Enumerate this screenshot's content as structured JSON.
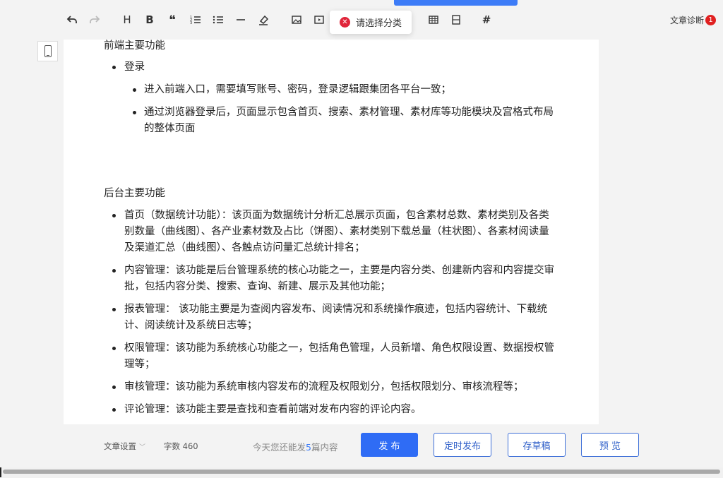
{
  "toolbar": {
    "header_icon": "H",
    "bold_icon": "B",
    "quote_icon": "❝",
    "tag_icon": "#",
    "diagnosis_label": "文章诊断",
    "diagnosis_count": "1"
  },
  "toast": {
    "message": "请选择分类",
    "icon": "x-circle-icon"
  },
  "content": {
    "section1_title": "前端主要功能",
    "login": "登录",
    "login_items": [
      "进入前端入口，需要填写账号、密码，登录逻辑跟集团各平台一致；",
      "通过浏览器登录后，页面显示包含首页、搜索、素材管理、素材库等功能模块及宫格式布局的整体页面"
    ],
    "section2_title": "后台主要功能",
    "backend_items": [
      "首页（数据统计功能）：该页面为数据统计分析汇总展示页面，包含素材总数、素材类别及各类别数量（曲线图）、各产业素材数及占比（饼图）、素材类别下载总量（柱状图）、各素材阅读量及渠道汇总（曲线图）、各触点访问量汇总统计排名；",
      "内容管理：该功能是后台管理系统的核心功能之一，主要是内容分类、创建新内容和内容提交审批，包括内容分类、搜索、查询、新建、展示及其他功能；",
      "报表管理： 该功能主要是为查阅内容发布、阅读情况和系统操作痕迹，包括内容统计、下载统计、阅读统计及系统日志等；",
      "权限管理：该功能为系统核心功能之一，包括角色管理，人员新增、角色权限设置、数据授权管理等；",
      "审核管理：该功能为系统审核内容发布的流程及权限划分，包括权限划分、审核流程等；",
      "评论管理：该功能主要是查找和查看前端对发布内容的评论内容。"
    ]
  },
  "footer": {
    "settings_label": "文章设置",
    "word_count": "字数 460",
    "remaining_prefix": "今天您还能发",
    "remaining_count": "5",
    "remaining_suffix": "篇内容",
    "publish": "发 布",
    "schedule": "定时发布",
    "draft": "存草稿",
    "preview": "预 览"
  }
}
